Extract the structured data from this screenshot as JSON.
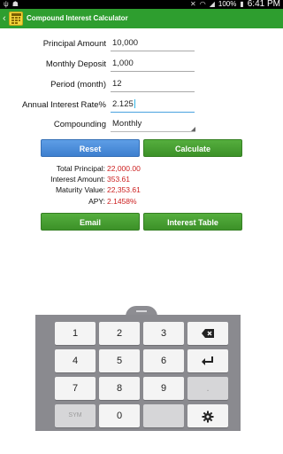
{
  "status_bar": {
    "left_icons": [
      "usb-icon",
      "android-debug-icon"
    ],
    "battery": "100%",
    "time": "6:41 PM",
    "icons": [
      "mute-icon",
      "wifi-icon",
      "signal-icon",
      "battery-icon"
    ]
  },
  "action_bar": {
    "title": "Compound Interest Calculator",
    "background": "#2e9e2f"
  },
  "form": {
    "principal": {
      "label": "Principal Amount",
      "value": "10,000"
    },
    "monthly_deposit": {
      "label": "Monthly Deposit",
      "value": "1,000"
    },
    "period": {
      "label": "Period (month)",
      "value": "12"
    },
    "rate": {
      "label": "Annual Interest Rate%",
      "value": "2.125"
    },
    "compounding": {
      "label": "Compounding",
      "value": "Monthly"
    }
  },
  "buttons": {
    "reset": "Reset",
    "calculate": "Calculate",
    "email": "Email",
    "interest_table": "Interest Table"
  },
  "results": {
    "total_principal": {
      "label": "Total Principal:",
      "value": "22,000.00"
    },
    "interest_amount": {
      "label": "Interest Amount:",
      "value": "353.61"
    },
    "maturity_value": {
      "label": "Maturity Value:",
      "value": "22,353.61"
    },
    "apy": {
      "label": "APY:",
      "value": "2.1458%"
    }
  },
  "keyboard": {
    "keys": {
      "k1": "1",
      "k2": "2",
      "k3": "3",
      "k4": "4",
      "k5": "5",
      "k6": "6",
      "k7": "7",
      "k8": "8",
      "k9": "9",
      "sym": "SYM",
      "k0": "0",
      "dot": "."
    }
  },
  "colors": {
    "accent_green": "#2e9e2f",
    "result_red": "#cc1f1f",
    "button_blue": "#4a8ad8",
    "button_green": "#48a033"
  }
}
